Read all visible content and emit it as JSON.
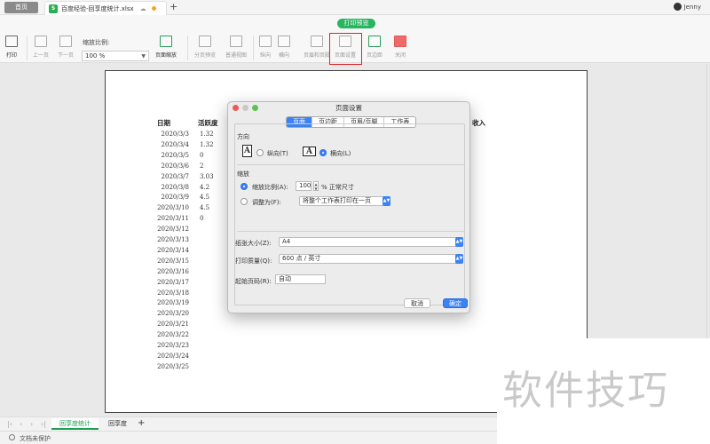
{
  "tabbar": {
    "home": "首页",
    "file_name": "百度经验-回享度统计.xlsx",
    "new_tab": "+",
    "user_name": "Jenny"
  },
  "mode_badge": "打印预览",
  "ribbon": {
    "print": "打印",
    "prev_page": "上一页",
    "next_page": "下一页",
    "scale_label": "缩放比例:",
    "scale_value": "100 %",
    "page_scale": "页面缩放",
    "page_break_preview": "分页预览",
    "normal_view": "普通视图",
    "portrait": "纵向",
    "landscape": "横向",
    "header_footer": "页眉和页脚",
    "page_setup": "页面设置",
    "margins": "页边距",
    "close": "关闭"
  },
  "sheet": {
    "headers": [
      "日期",
      "活跃度",
      "收入"
    ],
    "rows": [
      [
        "2020/3/3",
        "1.32"
      ],
      [
        "2020/3/4",
        "1.32"
      ],
      [
        "2020/3/5",
        "0"
      ],
      [
        "2020/3/6",
        "2"
      ],
      [
        "2020/3/7",
        "3.03"
      ],
      [
        "2020/3/8",
        "4.2"
      ],
      [
        "2020/3/9",
        "4.5"
      ],
      [
        "2020/3/10",
        "4.5"
      ],
      [
        "2020/3/11",
        "0"
      ],
      [
        "2020/3/12",
        ""
      ],
      [
        "2020/3/13",
        ""
      ],
      [
        "2020/3/14",
        ""
      ],
      [
        "2020/3/15",
        ""
      ],
      [
        "2020/3/16",
        ""
      ],
      [
        "2020/3/17",
        ""
      ],
      [
        "2020/3/18",
        ""
      ],
      [
        "2020/3/19",
        ""
      ],
      [
        "2020/3/20",
        ""
      ],
      [
        "2020/3/21",
        ""
      ],
      [
        "2020/3/22",
        ""
      ],
      [
        "2020/3/23",
        ""
      ],
      [
        "2020/3/24",
        ""
      ],
      [
        "2020/3/25",
        ""
      ]
    ]
  },
  "dialog": {
    "title": "页面设置",
    "tabs": [
      "页面",
      "页边距",
      "页眉/页脚",
      "工作表"
    ],
    "orientation_section": "方向",
    "portrait": "纵向(T)",
    "landscape": "横向(L)",
    "scaling_section": "缩放",
    "scale_to": "缩放比例(A):",
    "scale_value": "100",
    "scale_suffix": "% 正常尺寸",
    "fit_to": "调整为(F):",
    "fit_value": "将整个工作表打印在一页",
    "paper_size_label": "纸张大小(Z):",
    "paper_size_value": "A4",
    "print_quality_label": "打印质量(Q):",
    "print_quality_value": "600 点 / 英寸",
    "first_page_label": "起始页码(R):",
    "first_page_value": "自动",
    "cancel": "取消",
    "ok": "确定"
  },
  "sheetbar": {
    "tabs": [
      "回享度统计",
      "回享度"
    ],
    "add": "+"
  },
  "status": "文档未保护",
  "watermark": "软件技巧",
  "colors": {
    "accent_green": "#27b560",
    "dialog_blue": "#3b82f6",
    "highlight_red": "#e02424"
  }
}
